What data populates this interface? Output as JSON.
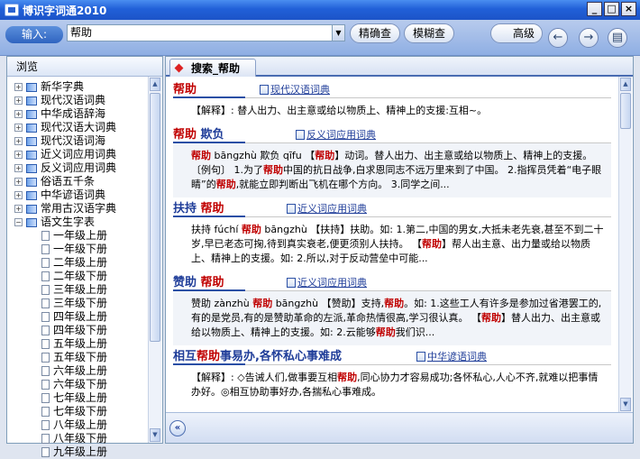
{
  "window": {
    "title": "博识字词通2010"
  },
  "toolbar": {
    "input_label": "输入:",
    "search_value": "帮助",
    "exact_button": "精确查",
    "fuzzy_button": "模糊查",
    "advanced_button": "高级"
  },
  "sidebar": {
    "header": "浏览",
    "items": [
      {
        "label": "新华字典"
      },
      {
        "label": "现代汉语词典"
      },
      {
        "label": "中华成语辞海"
      },
      {
        "label": "现代汉语大词典"
      },
      {
        "label": "现代汉语词海"
      },
      {
        "label": "近义词应用词典"
      },
      {
        "label": "反义词应用词典"
      },
      {
        "label": "俗语五千条"
      },
      {
        "label": "中华谚语词典"
      },
      {
        "label": "常用古汉语字典"
      },
      {
        "label": "语文生字表"
      }
    ],
    "children": [
      {
        "label": "一年级上册"
      },
      {
        "label": "一年级下册"
      },
      {
        "label": "二年级上册"
      },
      {
        "label": "二年级下册"
      },
      {
        "label": "三年级上册"
      },
      {
        "label": "三年级下册"
      },
      {
        "label": "四年级上册"
      },
      {
        "label": "四年级下册"
      },
      {
        "label": "五年级上册"
      },
      {
        "label": "五年级下册"
      },
      {
        "label": "六年级上册"
      },
      {
        "label": "六年级下册"
      },
      {
        "label": "七年级上册"
      },
      {
        "label": "七年级下册"
      },
      {
        "label": "八年级上册"
      },
      {
        "label": "八年级下册"
      },
      {
        "label": "九年级上册"
      }
    ]
  },
  "tab": {
    "label": "搜索_帮助"
  },
  "entries": [
    {
      "term_parts": [
        {
          "t": "帮助",
          "red": true
        }
      ],
      "dict": "现代汉语词典",
      "body": [
        {
          "t": "【解释】: 替人出力、出主意或给以物质上、精神上的支援:互相~。"
        }
      ]
    },
    {
      "term_parts": [
        {
          "t": "帮助",
          "red": true
        },
        {
          "t": "  欺负"
        }
      ],
      "dict": "反义词应用词典",
      "body": [
        {
          "t": "帮助",
          "red": true
        },
        {
          "t": " bāngzhù 欺负 qīfu 【"
        },
        {
          "t": "帮助",
          "red": true
        },
        {
          "t": "】动词。替人出力、出主意或给以物质上、精神上的支援。〔例句〕 1.为了"
        },
        {
          "t": "帮助",
          "red": true
        },
        {
          "t": "中国的抗日战争,白求恩同志不远万里来到了中国。 2.指挥员凭着“电子眼睛”的"
        },
        {
          "t": "帮助",
          "red": true
        },
        {
          "t": ",就能立即判断出飞机在哪个方向。 3.同学之间..."
        }
      ]
    },
    {
      "term_parts": [
        {
          "t": "扶持  "
        },
        {
          "t": "帮助",
          "red": true
        }
      ],
      "dict": "近义词应用词典",
      "body": [
        {
          "t": "扶持 fúchí "
        },
        {
          "t": "帮助",
          "red": true
        },
        {
          "t": " bāngzhù 【扶持】扶助。如: 1.第二,中国的男女,大抵未老先衰,甚至不到二十岁,早已老态可掬,待到真实衰老,便更须别人扶持。 【"
        },
        {
          "t": "帮助",
          "red": true
        },
        {
          "t": "】帮人出主意、出力量或给以物质上、精神上的支援。如: 2.所以,对于反动营垒中可能..."
        }
      ]
    },
    {
      "term_parts": [
        {
          "t": "赞助  "
        },
        {
          "t": "帮助",
          "red": true
        }
      ],
      "dict": "近义词应用词典",
      "body": [
        {
          "t": "赞助 zànzhù "
        },
        {
          "t": "帮助",
          "red": true
        },
        {
          "t": " bāngzhù 【赞助】支持,"
        },
        {
          "t": "帮助",
          "red": true
        },
        {
          "t": "。如: 1.这些工人有许多是参加过省港罢工的,有的是党员,有的是赞助革命的左派,革命热情很高,学习很认真。 【"
        },
        {
          "t": "帮助",
          "red": true
        },
        {
          "t": "】替人出力、出主意或给以物质上、精神上的支援。如: 2.云能够"
        },
        {
          "t": "帮助",
          "red": true
        },
        {
          "t": "我们识..."
        }
      ]
    },
    {
      "term_parts": [
        {
          "t": "相互"
        },
        {
          "t": "帮助",
          "red": true
        },
        {
          "t": "事易办,各怀私心事难成"
        }
      ],
      "dict": "中华谚语词典",
      "body": [
        {
          "t": "【解释】: ◇告诫人们,做事要互相"
        },
        {
          "t": "帮助",
          "red": true
        },
        {
          "t": ",同心协力才容易成功;各怀私心,人心不齐,就难以把事情办好。◎相互协助事好办,各揣私心事难成。"
        }
      ]
    }
  ]
}
